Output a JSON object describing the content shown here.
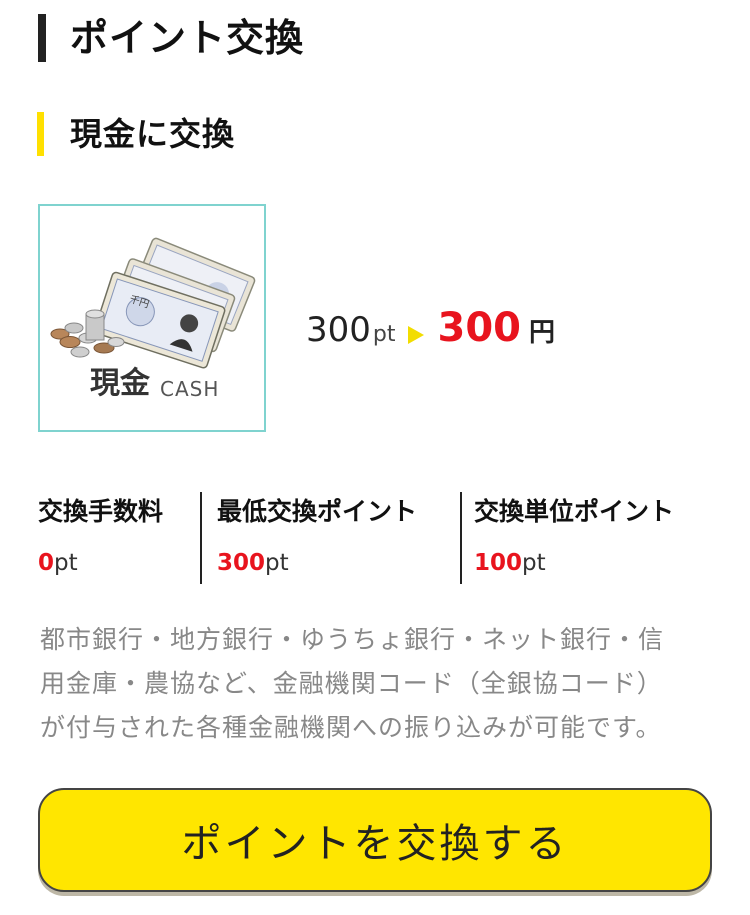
{
  "page": {
    "title": "ポイント交換",
    "subtitle": "現金に交換"
  },
  "card": {
    "label": "現金",
    "label_sub": "CASH",
    "banknote_text": "千円",
    "icon": "cash-banknotes-icon"
  },
  "rate": {
    "from_value": "300",
    "from_unit": "pt",
    "to_value": "300",
    "to_unit": "円",
    "arrow_icon": "triangle-right-icon"
  },
  "stats": [
    {
      "label": "交換手数料",
      "value": "0",
      "unit": "pt"
    },
    {
      "label": "最低交換ポイント",
      "value": "300",
      "unit": "pt"
    },
    {
      "label": "交換単位ポイント",
      "value": "100",
      "unit": "pt"
    }
  ],
  "description": {
    "line1": "都市銀行・地方銀行・ゆうちょ銀行・ネット銀行・信",
    "line2": "用金庫・農協など、金融機関コード（全銀協コード）",
    "line3": "が付与された各種金融機関への振り込みが可能です。"
  },
  "button": {
    "label": "ポイントを交換する"
  },
  "colors": {
    "accent_yellow": "#ffe600",
    "value_red": "#e8141e",
    "card_border": "#7fd3cf",
    "description_gray": "#888888"
  }
}
